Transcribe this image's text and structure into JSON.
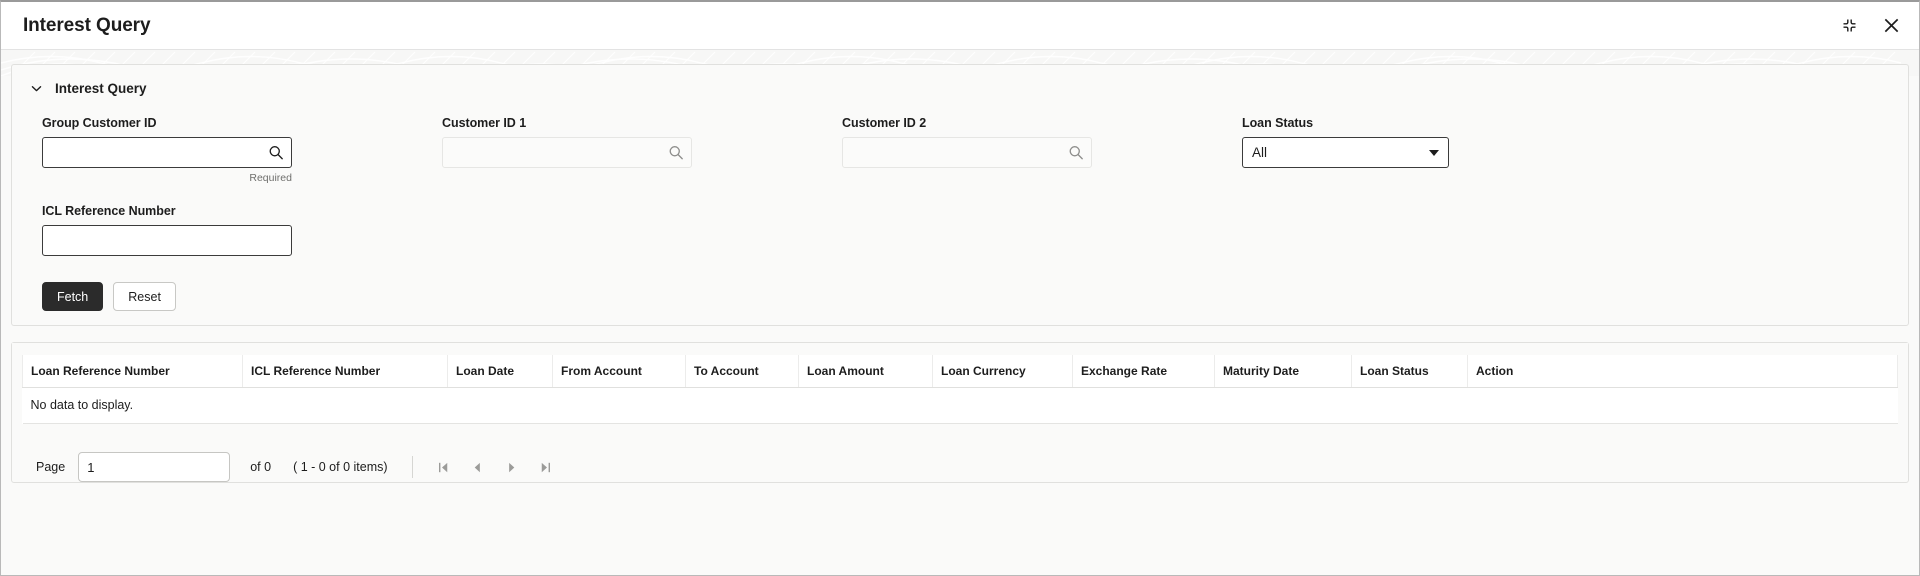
{
  "window": {
    "title": "Interest Query",
    "restore_icon": "restore-down-icon",
    "close_icon": "close-icon"
  },
  "query_section": {
    "title": "Interest Query",
    "collapse_icon": "chevron-down-icon",
    "fields": {
      "group_customer_id": {
        "label": "Group Customer ID",
        "value": "",
        "placeholder": "",
        "hint": "Required",
        "icon": "search-icon"
      },
      "customer_id_1": {
        "label": "Customer ID 1",
        "value": "",
        "placeholder": "",
        "icon": "search-icon"
      },
      "customer_id_2": {
        "label": "Customer ID 2",
        "value": "",
        "placeholder": "",
        "icon": "search-icon"
      },
      "loan_status": {
        "label": "Loan Status",
        "value": "All",
        "caret_icon": "chevron-down-icon"
      },
      "icl_reference_number": {
        "label": "ICL Reference Number",
        "value": "",
        "placeholder": ""
      }
    },
    "buttons": {
      "fetch": "Fetch",
      "reset": "Reset"
    }
  },
  "results": {
    "columns": [
      "Loan Reference Number",
      "ICL Reference Number",
      "Loan Date",
      "From Account",
      "To Account",
      "Loan Amount",
      "Loan Currency",
      "Exchange Rate",
      "Maturity Date",
      "Loan Status",
      "Action"
    ],
    "empty_message": "No data to display.",
    "rows": []
  },
  "pagination": {
    "page_label": "Page",
    "page_value": "1",
    "of_text": "of 0",
    "items_text": "( 1 - 0 of 0 items)",
    "first_icon": "first-page-icon",
    "prev_icon": "previous-page-icon",
    "next_icon": "next-page-icon",
    "last_icon": "last-page-icon"
  },
  "colors": {
    "primary_button": "#2b2b2b",
    "panel_background": "#fafaf9",
    "border": "#e0e0de"
  }
}
